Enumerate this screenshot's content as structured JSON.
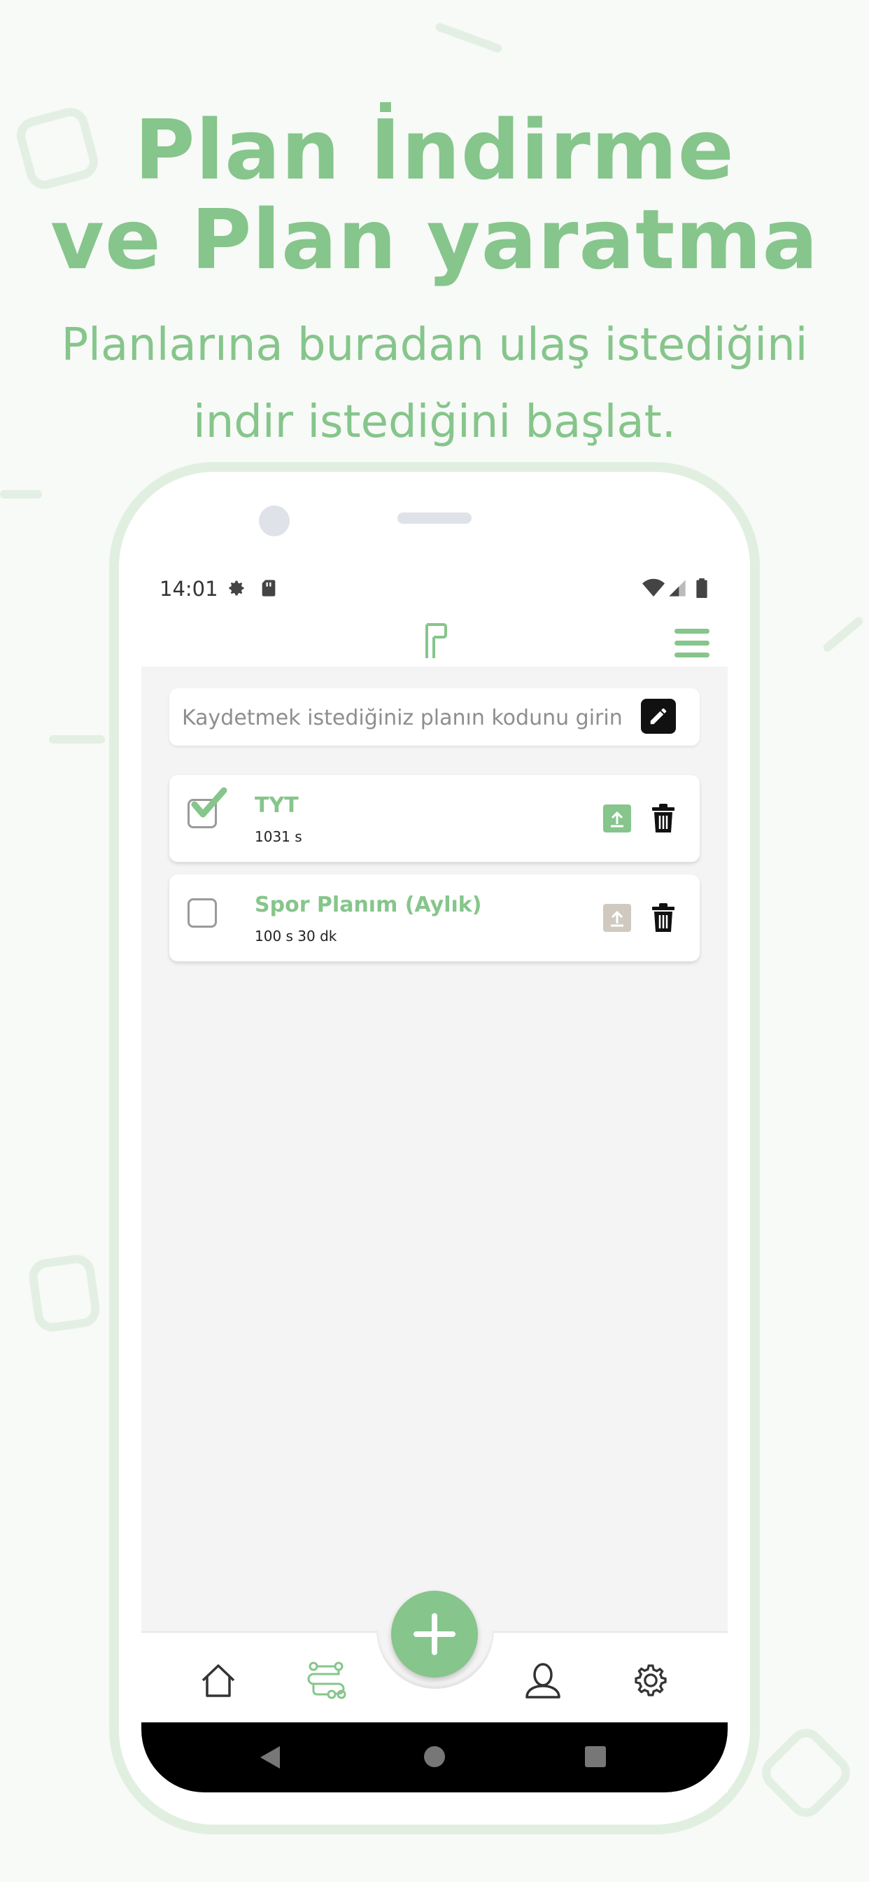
{
  "headline": {
    "line1": "Plan İndirme",
    "line2": "ve Plan yaratma"
  },
  "subline": {
    "line1": "Planlarına buradan ulaş istediğini",
    "line2": "indir istediğini başlat."
  },
  "statusbar": {
    "time": "14:01",
    "icons": [
      "settings-icon",
      "sd-card-icon",
      "wifi-icon",
      "signal-icon",
      "battery-icon"
    ]
  },
  "appbar": {
    "logo": "plan-logo",
    "menu_icon": "hamburger-menu-icon"
  },
  "code_input": {
    "placeholder": "Kaydetmek istediğiniz planın kodunu girin",
    "value": "",
    "action_icon": "edit-pencil-icon"
  },
  "plans": [
    {
      "name": "TYT",
      "duration": "1031 s",
      "checked": true,
      "upload_active": true
    },
    {
      "name": "Spor Planım (Aylık)",
      "duration": "100 s 30 dk",
      "checked": false,
      "upload_active": false
    }
  ],
  "bottom_nav": {
    "items": [
      "home-icon",
      "plans-route-icon",
      "add-icon",
      "profile-icon",
      "settings-icon"
    ],
    "active": "plans-route-icon"
  },
  "colors": {
    "accent": "#86c58b",
    "accent_light": "#e1efe1",
    "upload_inactive": "#cfc9c0",
    "content_bg": "#f4f4f4"
  }
}
